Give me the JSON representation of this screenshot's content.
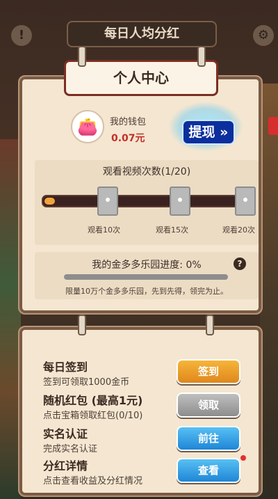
{
  "top_banner": {
    "title": "每日人均分红"
  },
  "personal_center": {
    "title": "个人中心",
    "wallet": {
      "label": "我的钱包",
      "amount": "0.07元",
      "withdraw_label": "提现 »"
    },
    "videos": {
      "title": "观看视频次数(1/20)",
      "progress_fraction": 0.05,
      "milestones": [
        "观看10次",
        "观看15次",
        "观看20次"
      ]
    },
    "garden": {
      "title": "我的金多多乐园进度: 0%",
      "progress_fraction": 0.0,
      "note": "限量10万个金多多乐园，先到先得，领完为止。",
      "help_icon": "?"
    }
  },
  "tasks": [
    {
      "title": "每日签到",
      "desc": "签到可领取1000金币",
      "button": "签到",
      "style": "orange"
    },
    {
      "title": "随机红包 (最高1元)",
      "desc": "点击宝箱领取红包(0/10)",
      "button": "领取",
      "style": "gray"
    },
    {
      "title": "实名认证",
      "desc": "完成实名认证",
      "button": "前往",
      "style": "blue"
    },
    {
      "title": "分红详情",
      "desc": "点击查看收益及分红情况",
      "button": "查看",
      "style": "blue"
    }
  ],
  "colors": {
    "accent_orange": "#e0871c",
    "accent_blue": "#1e86d6",
    "wallet_red": "#c0302a"
  }
}
